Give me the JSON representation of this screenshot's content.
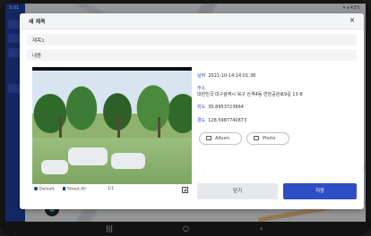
{
  "status": {
    "left": "5:01",
    "right": "▾ ◂ 43%"
  },
  "dialog": {
    "title": "새 제목",
    "close_glyph": "×",
    "field_title_value": "제목1",
    "field_content_value": "내용"
  },
  "photo_footer": {
    "radio1": "Default",
    "radio2": "Street-All",
    "count": "1/1"
  },
  "info": {
    "datetime_label": "날짜",
    "datetime_value": "2021-10-14 14:01:38",
    "address_label": "주소",
    "address_value": "대한민국 대구광역시 북구 산격4동 연암공원로9길 13-8",
    "lat_label": "위도",
    "lat_value": "35.8953723864",
    "lon_label": "경도",
    "lon_value": "128.5987740873"
  },
  "buttons": {
    "album": "Album",
    "photo": "Photo",
    "cancel": "닫기",
    "save": "저장"
  },
  "nav": {
    "recent": "|||",
    "home": "○",
    "back": "‹"
  },
  "colors": {
    "accent": "#2d4ec4",
    "label": "#2f55c8",
    "app_bar": "#1f3fa0"
  }
}
